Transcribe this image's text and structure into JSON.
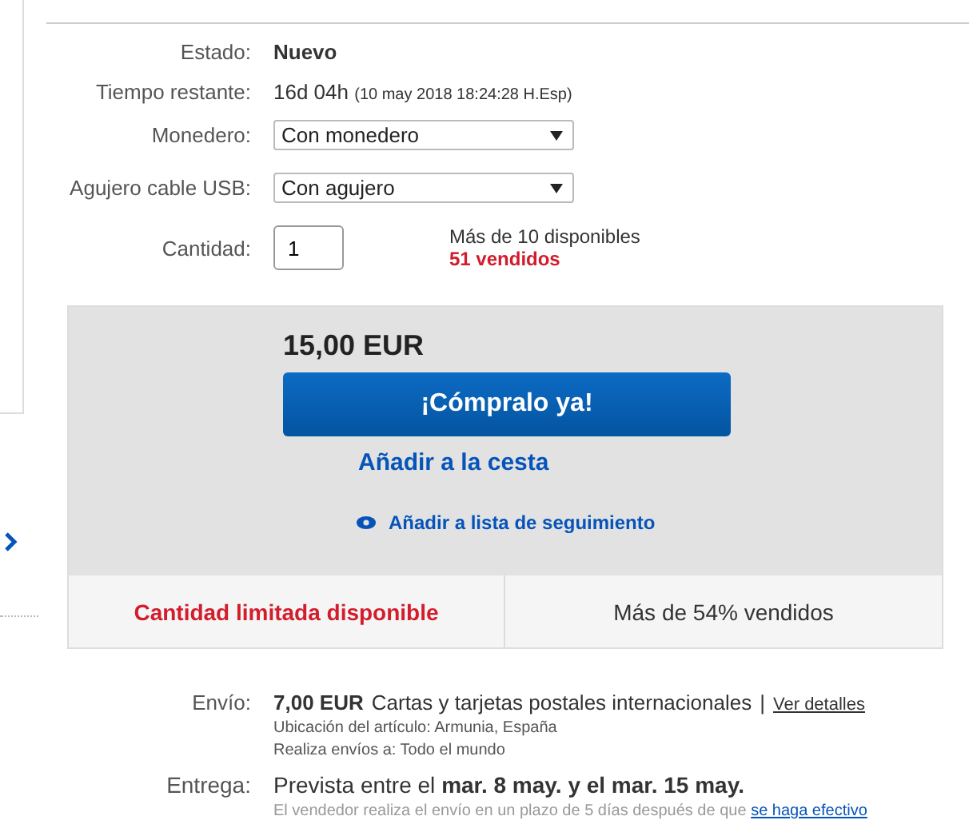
{
  "condition": {
    "label": "Estado:",
    "value": "Nuevo"
  },
  "time_left": {
    "label": "Tiempo restante:",
    "value": "16d 04h",
    "end": "(10 may 2018  18:24:28 H.Esp)"
  },
  "options": [
    {
      "label": "Monedero:",
      "value": "Con monedero"
    },
    {
      "label": "Agujero cable USB:",
      "value": "Con agujero"
    }
  ],
  "quantity": {
    "label": "Cantidad:",
    "value": "1",
    "available": "Más de 10 disponibles",
    "sold": "51 vendidos"
  },
  "buy_box": {
    "price": "15,00 EUR",
    "buy_now": "¡Cómpralo ya!",
    "add_to_cart": "Añadir a la cesta",
    "watch": "Añadir a lista de seguimiento",
    "urgency": "Cantidad limitada disponible",
    "sold_share": "Más de 54% vendidos"
  },
  "shipping": {
    "label": "Envío:",
    "price": "7,00 EUR",
    "service": "Cartas y tarjetas postales internacionales",
    "separator": "|",
    "details_link": "Ver detalles",
    "location": "Ubicación del artículo:  Armunia, España",
    "ships_to": "Realiza envíos a:  Todo el mundo"
  },
  "delivery": {
    "label": "Entrega:",
    "estimate": "Prevista entre el **mar. 8 may. y el mar. 15 may.**",
    "note": "El vendedor realiza el envío en un plazo de 5 días después de que",
    "note_link": "se haga efectivo"
  }
}
